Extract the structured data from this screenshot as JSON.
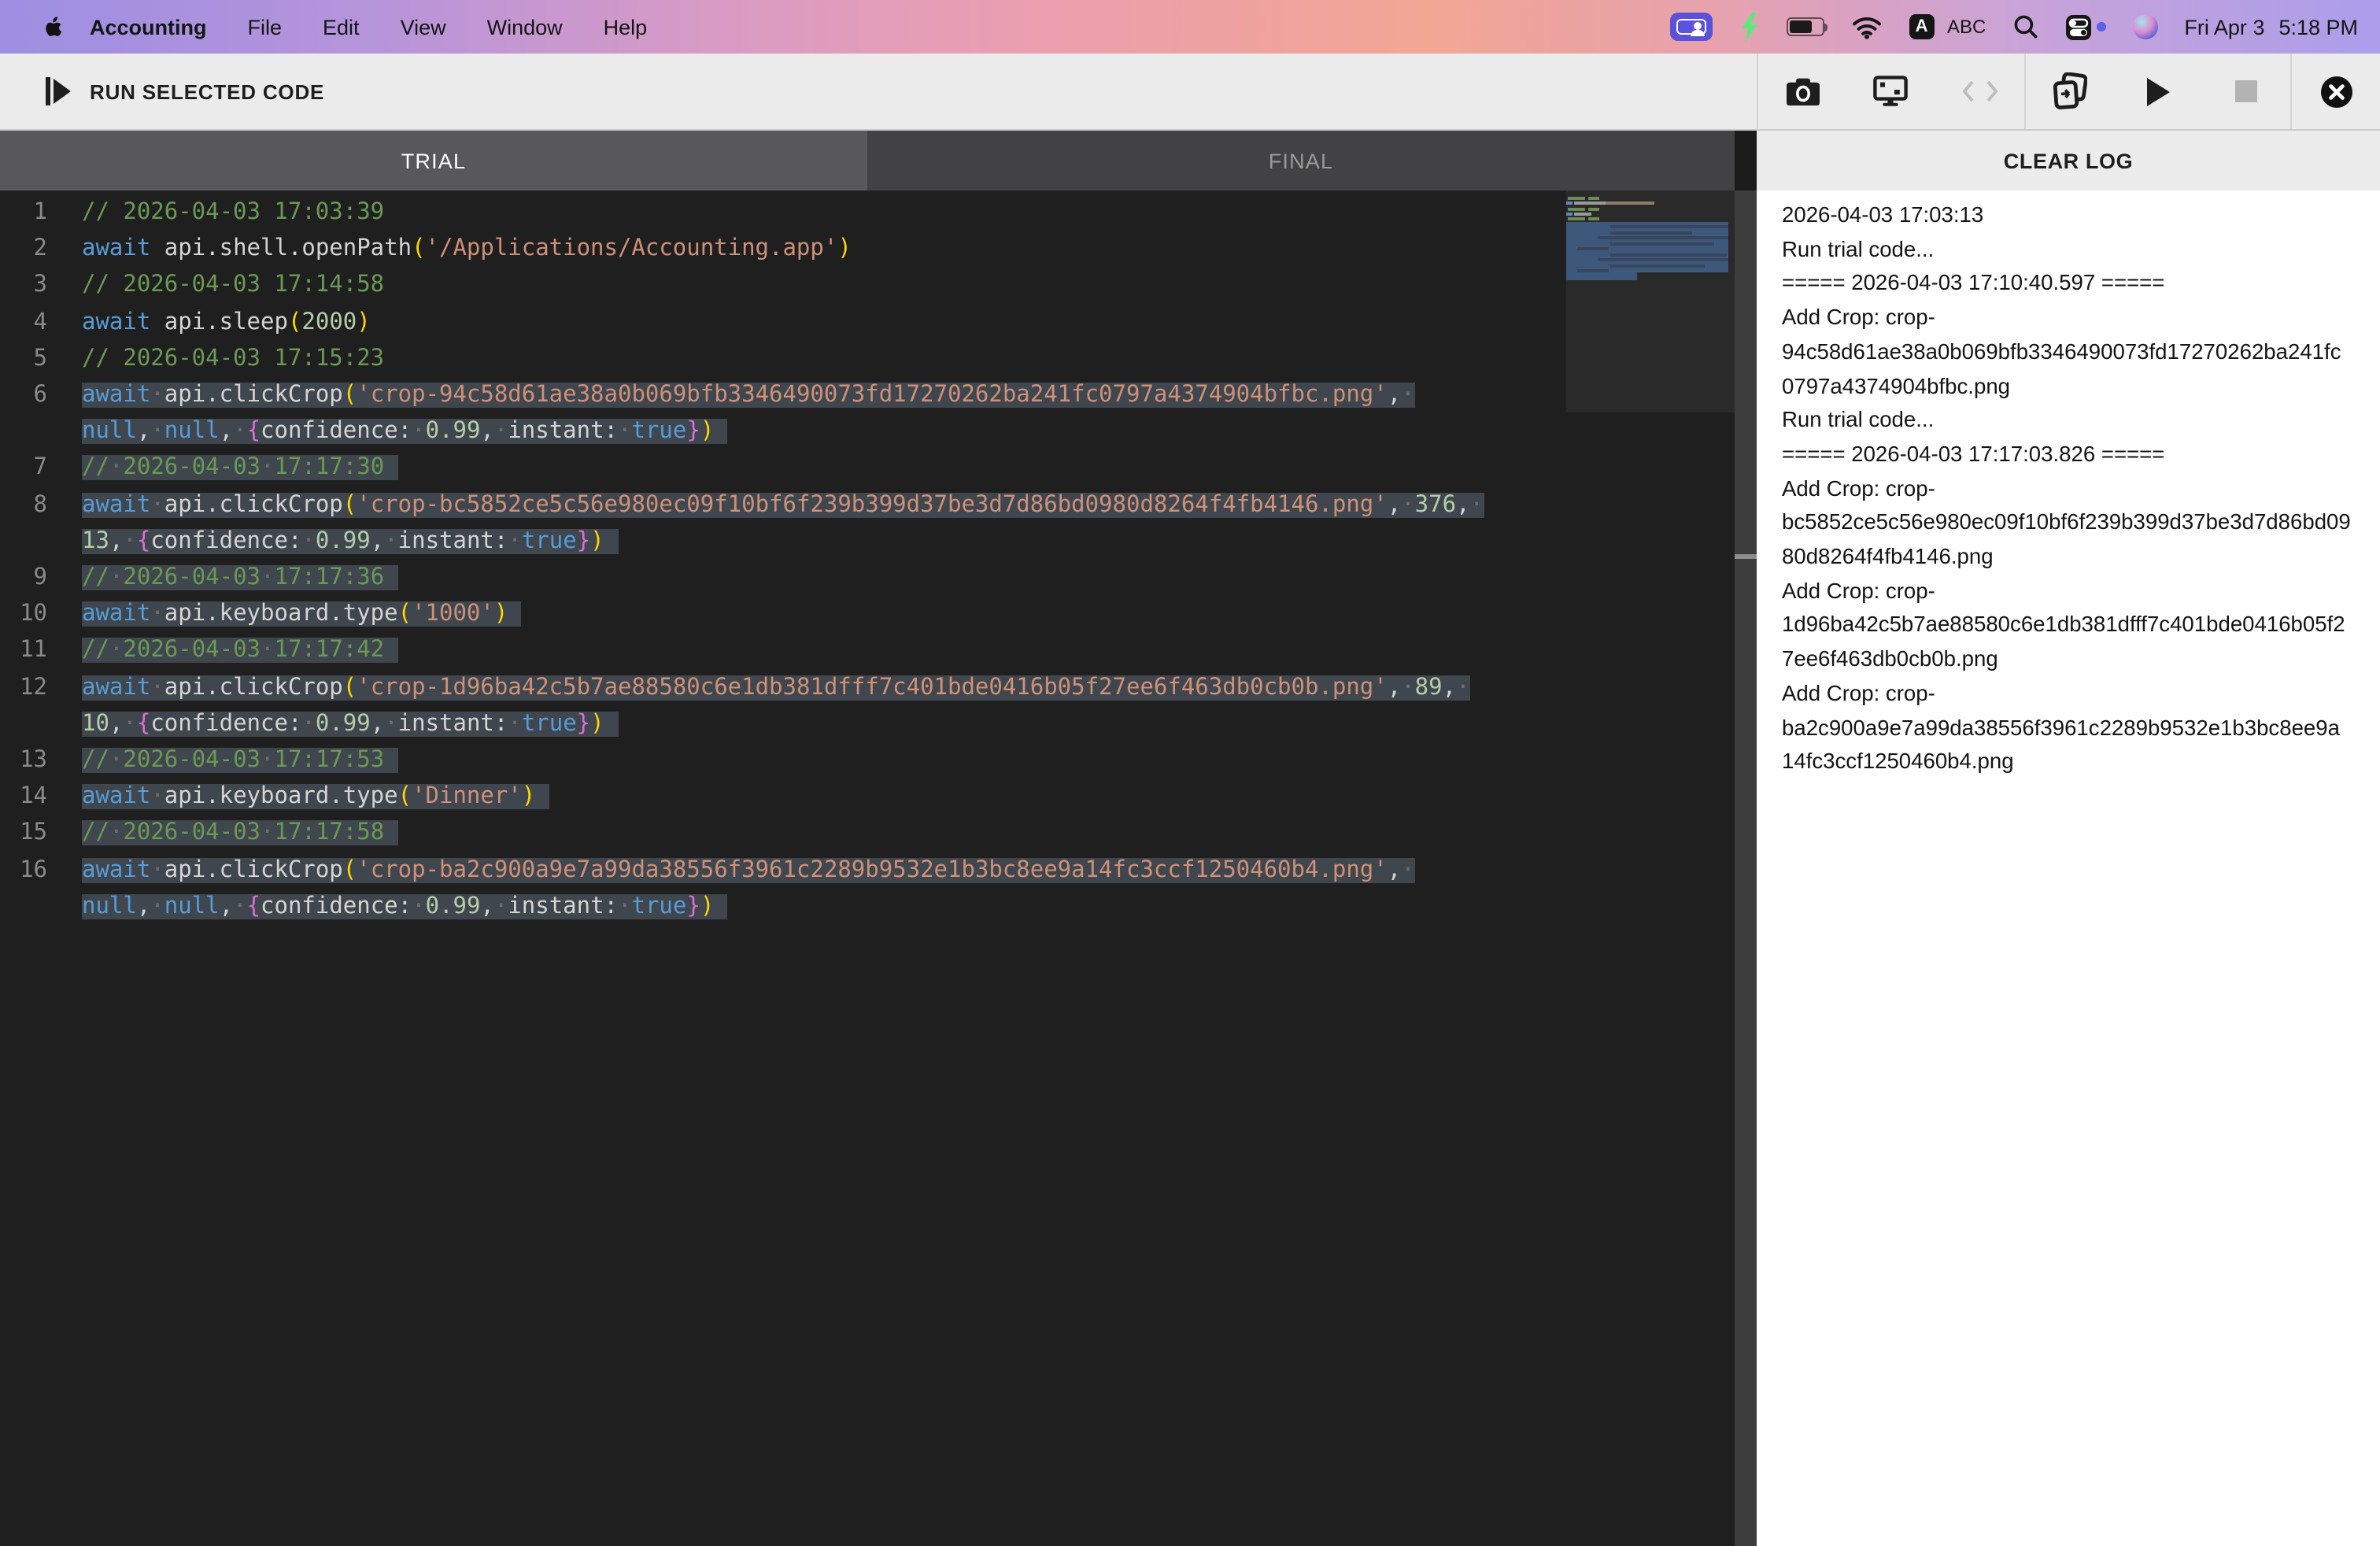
{
  "menu_bar": {
    "app_name": "Accounting",
    "menus": [
      "File",
      "Edit",
      "View",
      "Window",
      "Help"
    ],
    "status": {
      "input_letter": "A",
      "input_label": "ABC",
      "clock_date": "Fri Apr 3",
      "clock_time": "5:18 PM"
    }
  },
  "toolbar": {
    "run_label": "RUN SELECTED CODE",
    "icons": [
      "screenshot-camera",
      "display-capture",
      "code-disabled",
      "duplicate-run",
      "play",
      "stop-disabled",
      "close"
    ]
  },
  "tabs": {
    "trial": "TRIAL",
    "final": "FINAL"
  },
  "panel": {
    "clear_log_label": "CLEAR LOG",
    "log_lines": [
      "2026-04-03 17:03:13",
      "Run trial code...",
      "===== 2026-04-03 17:10:40.597 =====",
      "Add Crop: crop-94c58d61ae38a0b069bfb3346490073fd17270262ba241fc0797a4374904bfbc.png",
      "Run trial code...",
      "===== 2026-04-03 17:17:03.826 =====",
      "Add Crop: crop-bc5852ce5c56e980ec09f10bf6f239b399d37be3d7d86bd0980d8264f4fb4146.png",
      "Add Crop: crop-1d96ba42c5b7ae88580c6e1db381dfff7c401bde0416b05f27ee6f463db0cb0b.png",
      "Add Crop: crop-ba2c900a9e7a99da38556f3961c2289b9532e1b3bc8ee9a14fc3ccf1250460b4.png"
    ]
  },
  "colors": {
    "selection": "#40464e",
    "editor_bg": "#1f1f1f",
    "comment": "#6a9955",
    "keyword": "#569cd6",
    "string": "#ce9178",
    "number": "#b5cea8",
    "bracket1": "#ffd700",
    "bracket2": "#da70d6",
    "tab_active_bg": "#58585a",
    "tab_inactive_bg": "#424244",
    "screenshare_accent": "#5a52db",
    "bolt_green": "#5fe87a"
  },
  "editor": {
    "lines": [
      {
        "n": "1",
        "sel": false,
        "tok": [
          [
            "c",
            "// 2026-04-03 17:03:39"
          ]
        ]
      },
      {
        "n": "2",
        "sel": false,
        "tok": [
          [
            "k",
            "await"
          ],
          [
            "t",
            " api.shell.openPath"
          ],
          [
            "b1",
            "("
          ],
          [
            "s",
            "'/Applications/Accounting.app'"
          ],
          [
            "b1",
            ")"
          ]
        ]
      },
      {
        "n": "3",
        "sel": false,
        "tok": [
          [
            "c",
            "// 2026-04-03 17:14:58"
          ]
        ]
      },
      {
        "n": "4",
        "sel": false,
        "tok": [
          [
            "k",
            "await"
          ],
          [
            "t",
            " api.sleep"
          ],
          [
            "b1",
            "("
          ],
          [
            "n",
            "2000"
          ],
          [
            "b1",
            ")"
          ]
        ]
      },
      {
        "n": "5",
        "sel": false,
        "tok": [
          [
            "c",
            "// 2026-04-03 17:15:23"
          ]
        ]
      },
      {
        "n": "6",
        "sel": true,
        "tok": [
          [
            "k",
            "await"
          ],
          [
            "t",
            " api.clickCrop"
          ],
          [
            "b1",
            "("
          ],
          [
            "s",
            "'crop-94c58d61ae38a0b069bfb3346490073fd17270262ba241fc0797a4374904bfbc.png'"
          ],
          [
            "t",
            ", "
          ],
          [
            "k",
            "null"
          ],
          [
            "t",
            ", "
          ],
          [
            "k",
            "null"
          ],
          [
            "t",
            ", "
          ],
          [
            "b2",
            "{"
          ],
          [
            "t",
            "confidence: "
          ],
          [
            "n",
            "0.99"
          ],
          [
            "t",
            ", instant: "
          ],
          [
            "k",
            "true"
          ],
          [
            "b2",
            "}"
          ],
          [
            "b1",
            ")"
          ]
        ]
      },
      {
        "n": "7",
        "sel": true,
        "tok": [
          [
            "c",
            "// 2026-04-03 17:17:30"
          ]
        ]
      },
      {
        "n": "8",
        "sel": true,
        "tok": [
          [
            "k",
            "await"
          ],
          [
            "t",
            " api.clickCrop"
          ],
          [
            "b1",
            "("
          ],
          [
            "s",
            "'crop-bc5852ce5c56e980ec09f10bf6f239b399d37be3d7d86bd0980d8264f4fb4146.png'"
          ],
          [
            "t",
            ", "
          ],
          [
            "n",
            "376"
          ],
          [
            "t",
            ", "
          ],
          [
            "n",
            "13"
          ],
          [
            "t",
            ", "
          ],
          [
            "b2",
            "{"
          ],
          [
            "t",
            "confidence: "
          ],
          [
            "n",
            "0.99"
          ],
          [
            "t",
            ", instant: "
          ],
          [
            "k",
            "true"
          ],
          [
            "b2",
            "}"
          ],
          [
            "b1",
            ")"
          ]
        ]
      },
      {
        "n": "9",
        "sel": true,
        "tok": [
          [
            "c",
            "// 2026-04-03 17:17:36"
          ]
        ]
      },
      {
        "n": "10",
        "sel": true,
        "tok": [
          [
            "k",
            "await"
          ],
          [
            "t",
            " api.keyboard.type"
          ],
          [
            "b1",
            "("
          ],
          [
            "s",
            "'1000'"
          ],
          [
            "b1",
            ")"
          ]
        ]
      },
      {
        "n": "11",
        "sel": true,
        "tok": [
          [
            "c",
            "// 2026-04-03 17:17:42"
          ]
        ]
      },
      {
        "n": "12",
        "sel": true,
        "tok": [
          [
            "k",
            "await"
          ],
          [
            "t",
            " api.clickCrop"
          ],
          [
            "b1",
            "("
          ],
          [
            "s",
            "'crop-1d96ba42c5b7ae88580c6e1db381dfff7c401bde0416b05f27ee6f463db0cb0b.png'"
          ],
          [
            "t",
            ", "
          ],
          [
            "n",
            "89"
          ],
          [
            "t",
            ", "
          ],
          [
            "n",
            "10"
          ],
          [
            "t",
            ", "
          ],
          [
            "b2",
            "{"
          ],
          [
            "t",
            "confidence: "
          ],
          [
            "n",
            "0.99"
          ],
          [
            "t",
            ", instant: "
          ],
          [
            "k",
            "true"
          ],
          [
            "b2",
            "}"
          ],
          [
            "b1",
            ")"
          ]
        ]
      },
      {
        "n": "13",
        "sel": true,
        "tok": [
          [
            "c",
            "// 2026-04-03 17:17:53"
          ]
        ]
      },
      {
        "n": "14",
        "sel": true,
        "tok": [
          [
            "k",
            "await"
          ],
          [
            "t",
            " api.keyboard.type"
          ],
          [
            "b1",
            "("
          ],
          [
            "s",
            "'Dinner'"
          ],
          [
            "b1",
            ")"
          ]
        ]
      },
      {
        "n": "15",
        "sel": true,
        "tok": [
          [
            "c",
            "// 2026-04-03 17:17:58"
          ]
        ]
      },
      {
        "n": "16",
        "sel": true,
        "tok": [
          [
            "k",
            "await"
          ],
          [
            "t",
            " api.clickCrop"
          ],
          [
            "b1",
            "("
          ],
          [
            "s",
            "'crop-ba2c900a9e7a99da38556f3961c2289b9532e1b3bc8ee9a14fc3ccf1250460b4.png'"
          ],
          [
            "t",
            ", "
          ],
          [
            "k",
            "null"
          ],
          [
            "t",
            ", "
          ],
          [
            "k",
            "null"
          ],
          [
            "t",
            ", "
          ],
          [
            "b2",
            "{"
          ],
          [
            "t",
            "confidence: "
          ],
          [
            "n",
            "0.99"
          ],
          [
            "t",
            ", instant: "
          ],
          [
            "k",
            "true"
          ],
          [
            "b2",
            "}"
          ],
          [
            "b1",
            ")"
          ]
        ]
      }
    ]
  }
}
